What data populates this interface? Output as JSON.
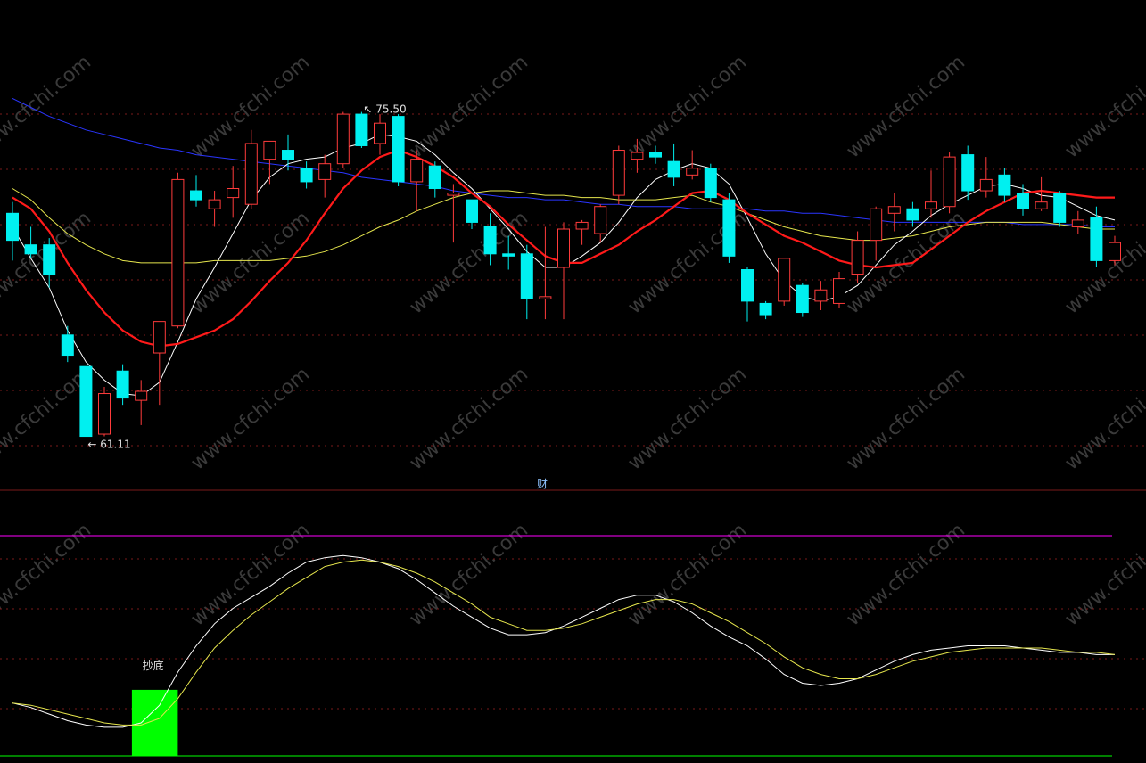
{
  "colors": {
    "background": "#000000",
    "up": "#ff3b3b",
    "down": "#00f0f0",
    "ma_white": "#ffffff",
    "ma_red": "#ff1a1a",
    "ma_yellow": "#e6e64d",
    "ma_blue": "#2a35ff",
    "grid": "#7a1a1a",
    "signal": "#00ff00",
    "magenta": "#ff00ff",
    "annotation": "#e0e0e0",
    "label_blue": "#8fc3ff"
  },
  "labels": {
    "high_marker": "75.50",
    "low_marker": "61.11",
    "divider": "财",
    "signal": "抄底",
    "watermark": "www.cfchi.com"
  },
  "chart_data": [
    {
      "type": "candlestick",
      "ylim": [
        59.5,
        77.5
      ],
      "grid": true,
      "annotations": [
        {
          "text": "75.50",
          "x": 19,
          "value": 75.5
        },
        {
          "text": "61.11",
          "x": 4,
          "value": 61.11
        }
      ],
      "candles": [
        {
          "x": 0,
          "o": 71.0,
          "h": 71.5,
          "l": 68.9,
          "c": 69.8
        },
        {
          "x": 1,
          "o": 69.6,
          "h": 70.4,
          "l": 69.0,
          "c": 69.2
        },
        {
          "x": 2,
          "o": 69.6,
          "h": 69.9,
          "l": 67.7,
          "c": 68.3
        },
        {
          "x": 3,
          "o": 65.6,
          "h": 66.0,
          "l": 64.4,
          "c": 64.7
        },
        {
          "x": 4,
          "o": 64.2,
          "h": 64.2,
          "l": 61.1,
          "c": 61.1
        },
        {
          "x": 5,
          "o": 61.2,
          "h": 63.3,
          "l": 61.1,
          "c": 63.0
        },
        {
          "x": 6,
          "o": 64.0,
          "h": 64.3,
          "l": 62.5,
          "c": 62.8
        },
        {
          "x": 7,
          "o": 62.7,
          "h": 63.6,
          "l": 61.6,
          "c": 63.1
        },
        {
          "x": 8,
          "o": 64.8,
          "h": 66.2,
          "l": 62.5,
          "c": 66.2
        },
        {
          "x": 9,
          "o": 66.0,
          "h": 72.8,
          "l": 65.9,
          "c": 72.5
        },
        {
          "x": 10,
          "o": 72.0,
          "h": 72.7,
          "l": 71.3,
          "c": 71.6
        },
        {
          "x": 11,
          "o": 71.2,
          "h": 72.0,
          "l": 70.4,
          "c": 71.6
        },
        {
          "x": 12,
          "o": 71.7,
          "h": 73.1,
          "l": 70.8,
          "c": 72.1
        },
        {
          "x": 13,
          "o": 71.4,
          "h": 74.7,
          "l": 71.2,
          "c": 74.1
        },
        {
          "x": 14,
          "o": 73.4,
          "h": 73.8,
          "l": 72.3,
          "c": 74.2
        },
        {
          "x": 15,
          "o": 73.8,
          "h": 74.5,
          "l": 72.9,
          "c": 73.4
        },
        {
          "x": 16,
          "o": 73.0,
          "h": 73.3,
          "l": 72.1,
          "c": 72.4
        },
        {
          "x": 17,
          "o": 72.5,
          "h": 73.6,
          "l": 71.7,
          "c": 73.2
        },
        {
          "x": 18,
          "o": 73.2,
          "h": 75.5,
          "l": 73.0,
          "c": 75.4
        },
        {
          "x": 19,
          "o": 75.4,
          "h": 75.5,
          "l": 73.9,
          "c": 74.0
        },
        {
          "x": 20,
          "o": 74.1,
          "h": 75.4,
          "l": 73.6,
          "c": 75.0
        },
        {
          "x": 21,
          "o": 75.3,
          "h": 75.4,
          "l": 72.2,
          "c": 72.4
        },
        {
          "x": 22,
          "o": 72.4,
          "h": 73.8,
          "l": 71.1,
          "c": 73.4
        },
        {
          "x": 23,
          "o": 73.1,
          "h": 73.3,
          "l": 71.7,
          "c": 72.1
        },
        {
          "x": 24,
          "o": 71.8,
          "h": 72.3,
          "l": 69.7,
          "c": 71.9
        },
        {
          "x": 25,
          "o": 71.6,
          "h": 71.6,
          "l": 70.3,
          "c": 70.6
        },
        {
          "x": 26,
          "o": 70.4,
          "h": 71.0,
          "l": 68.7,
          "c": 69.2
        },
        {
          "x": 27,
          "o": 69.2,
          "h": 70.0,
          "l": 68.5,
          "c": 69.1
        },
        {
          "x": 28,
          "o": 69.2,
          "h": 69.6,
          "l": 66.3,
          "c": 67.2
        },
        {
          "x": 29,
          "o": 67.2,
          "h": 70.4,
          "l": 66.3,
          "c": 67.3
        },
        {
          "x": 30,
          "o": 68.6,
          "h": 70.6,
          "l": 66.3,
          "c": 70.3
        },
        {
          "x": 31,
          "o": 70.3,
          "h": 70.7,
          "l": 69.6,
          "c": 70.6
        },
        {
          "x": 32,
          "o": 70.1,
          "h": 71.4,
          "l": 69.7,
          "c": 71.3
        },
        {
          "x": 33,
          "o": 71.8,
          "h": 74.0,
          "l": 71.4,
          "c": 73.8
        },
        {
          "x": 34,
          "o": 73.4,
          "h": 74.3,
          "l": 72.8,
          "c": 73.7
        },
        {
          "x": 35,
          "o": 73.7,
          "h": 74.0,
          "l": 73.2,
          "c": 73.5
        },
        {
          "x": 36,
          "o": 73.3,
          "h": 74.1,
          "l": 72.2,
          "c": 72.6
        },
        {
          "x": 37,
          "o": 72.7,
          "h": 73.8,
          "l": 72.5,
          "c": 73.0
        },
        {
          "x": 38,
          "o": 73.0,
          "h": 73.2,
          "l": 71.5,
          "c": 71.7
        },
        {
          "x": 39,
          "o": 71.6,
          "h": 71.9,
          "l": 68.8,
          "c": 69.1
        },
        {
          "x": 40,
          "o": 68.5,
          "h": 68.6,
          "l": 66.2,
          "c": 67.1
        },
        {
          "x": 41,
          "o": 67.0,
          "h": 67.1,
          "l": 66.3,
          "c": 66.5
        },
        {
          "x": 42,
          "o": 67.1,
          "h": 69.0,
          "l": 66.9,
          "c": 69.0
        },
        {
          "x": 43,
          "o": 67.8,
          "h": 67.9,
          "l": 66.4,
          "c": 66.6
        },
        {
          "x": 44,
          "o": 67.1,
          "h": 68.0,
          "l": 66.7,
          "c": 67.6
        },
        {
          "x": 45,
          "o": 67.0,
          "h": 68.4,
          "l": 66.8,
          "c": 68.1
        },
        {
          "x": 46,
          "o": 68.3,
          "h": 70.2,
          "l": 67.9,
          "c": 69.8
        },
        {
          "x": 47,
          "o": 69.8,
          "h": 71.3,
          "l": 68.9,
          "c": 71.2
        },
        {
          "x": 48,
          "o": 71.0,
          "h": 71.9,
          "l": 70.2,
          "c": 71.3
        },
        {
          "x": 49,
          "o": 71.2,
          "h": 71.5,
          "l": 70.4,
          "c": 70.7
        },
        {
          "x": 50,
          "o": 71.2,
          "h": 72.9,
          "l": 70.8,
          "c": 71.5
        },
        {
          "x": 51,
          "o": 71.3,
          "h": 73.7,
          "l": 71.0,
          "c": 73.5
        },
        {
          "x": 52,
          "o": 73.6,
          "h": 74.0,
          "l": 71.6,
          "c": 72.0
        },
        {
          "x": 53,
          "o": 72.0,
          "h": 73.5,
          "l": 71.7,
          "c": 72.5
        },
        {
          "x": 54,
          "o": 72.7,
          "h": 73.0,
          "l": 71.5,
          "c": 71.8
        },
        {
          "x": 55,
          "o": 71.9,
          "h": 72.3,
          "l": 70.9,
          "c": 71.2
        },
        {
          "x": 56,
          "o": 71.2,
          "h": 72.6,
          "l": 71.1,
          "c": 71.5
        },
        {
          "x": 57,
          "o": 71.9,
          "h": 72.0,
          "l": 70.4,
          "c": 70.6
        },
        {
          "x": 58,
          "o": 70.4,
          "h": 71.1,
          "l": 70.1,
          "c": 70.7
        },
        {
          "x": 59,
          "o": 70.8,
          "h": 71.3,
          "l": 68.6,
          "c": 68.9
        },
        {
          "x": 60,
          "o": 68.9,
          "h": 70.0,
          "l": 68.7,
          "c": 69.7
        }
      ],
      "series": [
        {
          "color": "ma_white",
          "values": [
            70.4,
            69.0,
            67.7,
            65.8,
            64.4,
            63.6,
            63.0,
            62.9,
            63.5,
            65.3,
            67.2,
            68.6,
            70.1,
            71.6,
            72.6,
            73.2,
            73.4,
            73.5,
            73.9,
            74.1,
            74.5,
            74.4,
            74.2,
            73.6,
            72.8,
            72.1,
            71.2,
            70.3,
            69.3,
            68.6,
            68.6,
            69.1,
            69.7,
            70.6,
            71.7,
            72.5,
            72.9,
            73.2,
            73.0,
            72.3,
            70.8,
            69.2,
            68.0,
            67.3,
            67.1,
            67.3,
            67.8,
            68.7,
            69.6,
            70.2,
            70.9,
            71.4,
            71.8,
            72.2,
            72.3,
            72.1,
            71.8,
            71.7,
            71.3,
            70.9,
            70.7
          ]
        },
        {
          "color": "ma_red",
          "values": [
            71.7,
            71.2,
            70.2,
            68.8,
            67.6,
            66.6,
            65.8,
            65.3,
            65.1,
            65.2,
            65.5,
            65.8,
            66.3,
            67.1,
            68.0,
            68.8,
            69.8,
            71.0,
            72.1,
            72.9,
            73.5,
            73.8,
            73.5,
            73.1,
            72.6,
            71.9,
            71.3,
            70.5,
            69.8,
            69.1,
            68.8,
            68.8,
            69.2,
            69.6,
            70.2,
            70.7,
            71.3,
            71.9,
            72.0,
            71.6,
            71.0,
            70.5,
            70.0,
            69.7,
            69.3,
            68.9,
            68.7,
            68.6,
            68.7,
            68.8,
            69.4,
            70.0,
            70.6,
            71.1,
            71.5,
            71.9,
            72.0,
            71.9,
            71.8,
            71.7,
            71.7
          ]
        },
        {
          "color": "ma_yellow",
          "values": [
            72.1,
            71.6,
            70.8,
            70.1,
            69.6,
            69.2,
            68.9,
            68.8,
            68.8,
            68.8,
            68.8,
            68.9,
            68.9,
            68.9,
            68.9,
            69.0,
            69.1,
            69.3,
            69.6,
            70.0,
            70.4,
            70.7,
            71.1,
            71.4,
            71.7,
            71.9,
            72.0,
            72.0,
            71.9,
            71.8,
            71.8,
            71.7,
            71.7,
            71.6,
            71.6,
            71.6,
            71.7,
            71.8,
            71.5,
            71.3,
            71.0,
            70.7,
            70.4,
            70.2,
            70.0,
            69.9,
            69.8,
            69.8,
            69.9,
            70.0,
            70.2,
            70.4,
            70.5,
            70.6,
            70.6,
            70.6,
            70.6,
            70.5,
            70.4,
            70.3,
            70.3
          ]
        },
        {
          "color": "ma_blue",
          "values": [
            76.1,
            75.7,
            75.3,
            75.0,
            74.7,
            74.5,
            74.3,
            74.1,
            73.9,
            73.8,
            73.6,
            73.5,
            73.4,
            73.3,
            73.2,
            73.1,
            73.0,
            72.9,
            72.8,
            72.6,
            72.5,
            72.4,
            72.3,
            72.2,
            72.0,
            71.9,
            71.8,
            71.7,
            71.7,
            71.6,
            71.6,
            71.5,
            71.4,
            71.4,
            71.3,
            71.3,
            71.3,
            71.2,
            71.2,
            71.2,
            71.2,
            71.1,
            71.1,
            71.0,
            71.0,
            70.9,
            70.8,
            70.7,
            70.6,
            70.6,
            70.6,
            70.6,
            70.6,
            70.6,
            70.6,
            70.5,
            70.5,
            70.5,
            70.5,
            70.4,
            70.4
          ]
        }
      ]
    },
    {
      "type": "line",
      "ylim": [
        0,
        100
      ],
      "grid": true,
      "series": [
        {
          "color": "ma_white",
          "values": [
            24,
            22,
            19,
            16,
            14,
            13,
            13,
            15,
            23,
            38,
            50,
            60,
            67,
            72,
            77,
            83,
            88,
            90,
            91,
            90,
            88,
            85,
            80,
            74,
            68,
            63,
            58,
            55,
            55,
            56,
            59,
            63,
            67,
            71,
            73,
            73,
            70,
            65,
            59,
            54,
            50,
            44,
            37,
            33,
            32,
            33,
            35,
            39,
            43,
            46,
            48,
            49,
            50,
            50,
            50,
            49,
            48,
            47,
            47,
            46,
            46
          ]
        },
        {
          "color": "ma_yellow",
          "values": [
            24,
            23,
            21,
            19,
            17,
            15,
            14,
            14,
            17,
            26,
            38,
            49,
            57,
            64,
            70,
            76,
            81,
            86,
            88,
            89,
            88,
            86,
            83,
            79,
            74,
            69,
            63,
            60,
            57,
            57,
            58,
            60,
            63,
            66,
            69,
            71,
            71,
            69,
            65,
            61,
            56,
            51,
            45,
            40,
            37,
            35,
            35,
            37,
            40,
            43,
            45,
            47,
            48,
            49,
            49,
            49,
            49,
            48,
            47,
            47,
            46
          ]
        }
      ],
      "bars": [
        {
          "x_start": 6.5,
          "x_end": 9.0,
          "value": 30,
          "label": "抄底"
        }
      ]
    }
  ]
}
